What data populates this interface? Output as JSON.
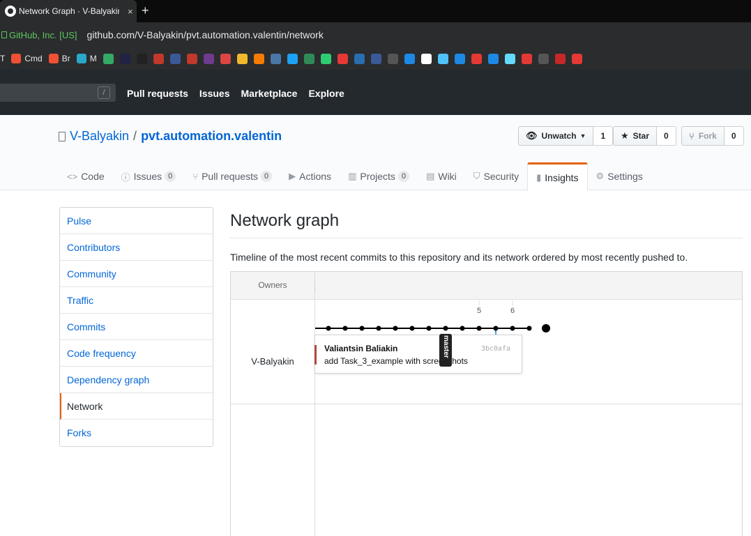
{
  "browser": {
    "tab_title": "Network Graph · V-Balyakin",
    "tab_close": "×",
    "new_tab": "+",
    "security_label": "GitHub, Inc. [US]",
    "url": "github.com/V-Balyakin/pvt.automation.valentin/network",
    "bookmarks": [
      {
        "label": "T",
        "color": ""
      },
      {
        "label": "Cmd",
        "color": "#f05033"
      },
      {
        "label": "Br",
        "color": "#f05033"
      },
      {
        "label": "M",
        "color": "#2aa7c9"
      }
    ],
    "bookmark_icons": [
      "#3a6",
      "#224",
      "#222",
      "#c0392b",
      "#3b5998",
      "#c0392b",
      "#6e3b8e",
      "#d44",
      "#f1b82d",
      "#f57c00",
      "#4a76a8",
      "#1da1f2",
      "#2e8b57",
      "#2ecc71",
      "#e53935",
      "#2a6db0",
      "#3b5998",
      "#555",
      "#1e88e5",
      "#fff",
      "#4fc3f7",
      "#1e88e5",
      "#e53935",
      "#1e88e5",
      "#61dafb",
      "#e53935",
      "#555",
      "#c62828",
      "#e53935"
    ]
  },
  "header": {
    "search_shortcut": "/",
    "nav": [
      "Pull requests",
      "Issues",
      "Marketplace",
      "Explore"
    ]
  },
  "repo": {
    "owner": "V-Balyakin",
    "separator": "/",
    "name": "pvt.automation.valentin",
    "unwatch_label": "Unwatch",
    "watch_count": "1",
    "star_label": "Star",
    "star_count": "0",
    "fork_label": "Fork",
    "fork_count": "0",
    "tabs": [
      {
        "label": "Code",
        "icon": "code-icon",
        "glyph": "<>",
        "badge": ""
      },
      {
        "label": "Issues",
        "icon": "issue-icon",
        "glyph": "ⓘ",
        "badge": "0"
      },
      {
        "label": "Pull requests",
        "icon": "pull-request-icon",
        "glyph": "⑂",
        "badge": "0"
      },
      {
        "label": "Actions",
        "icon": "play-icon",
        "glyph": "▶",
        "badge": ""
      },
      {
        "label": "Projects",
        "icon": "project-icon",
        "glyph": "▥",
        "badge": "0"
      },
      {
        "label": "Wiki",
        "icon": "book-icon",
        "glyph": "▤",
        "badge": ""
      },
      {
        "label": "Security",
        "icon": "shield-icon",
        "glyph": "⛉",
        "badge": ""
      },
      {
        "label": "Insights",
        "icon": "graph-icon",
        "glyph": "▮",
        "badge": "",
        "selected": true
      },
      {
        "label": "Settings",
        "icon": "gear-icon",
        "glyph": "⚙",
        "badge": ""
      }
    ]
  },
  "sidebar": {
    "items": [
      "Pulse",
      "Contributors",
      "Community",
      "Traffic",
      "Commits",
      "Code frequency",
      "Dependency graph",
      "Network",
      "Forks"
    ],
    "selected": "Network"
  },
  "main": {
    "title": "Network graph",
    "subtitle": "Timeline of the most recent commits to this repository and its network ordered by most recently pushed to."
  },
  "network": {
    "owners_header": "Owners",
    "owner": "V-Balyakin",
    "date_labels": [
      "5",
      "6"
    ],
    "commit_count": 14,
    "commit": {
      "author": "Valiantsin Baliakin",
      "message": "add Task_3_example with screenshots",
      "sha": "3bc0afa"
    },
    "branch": "master"
  }
}
